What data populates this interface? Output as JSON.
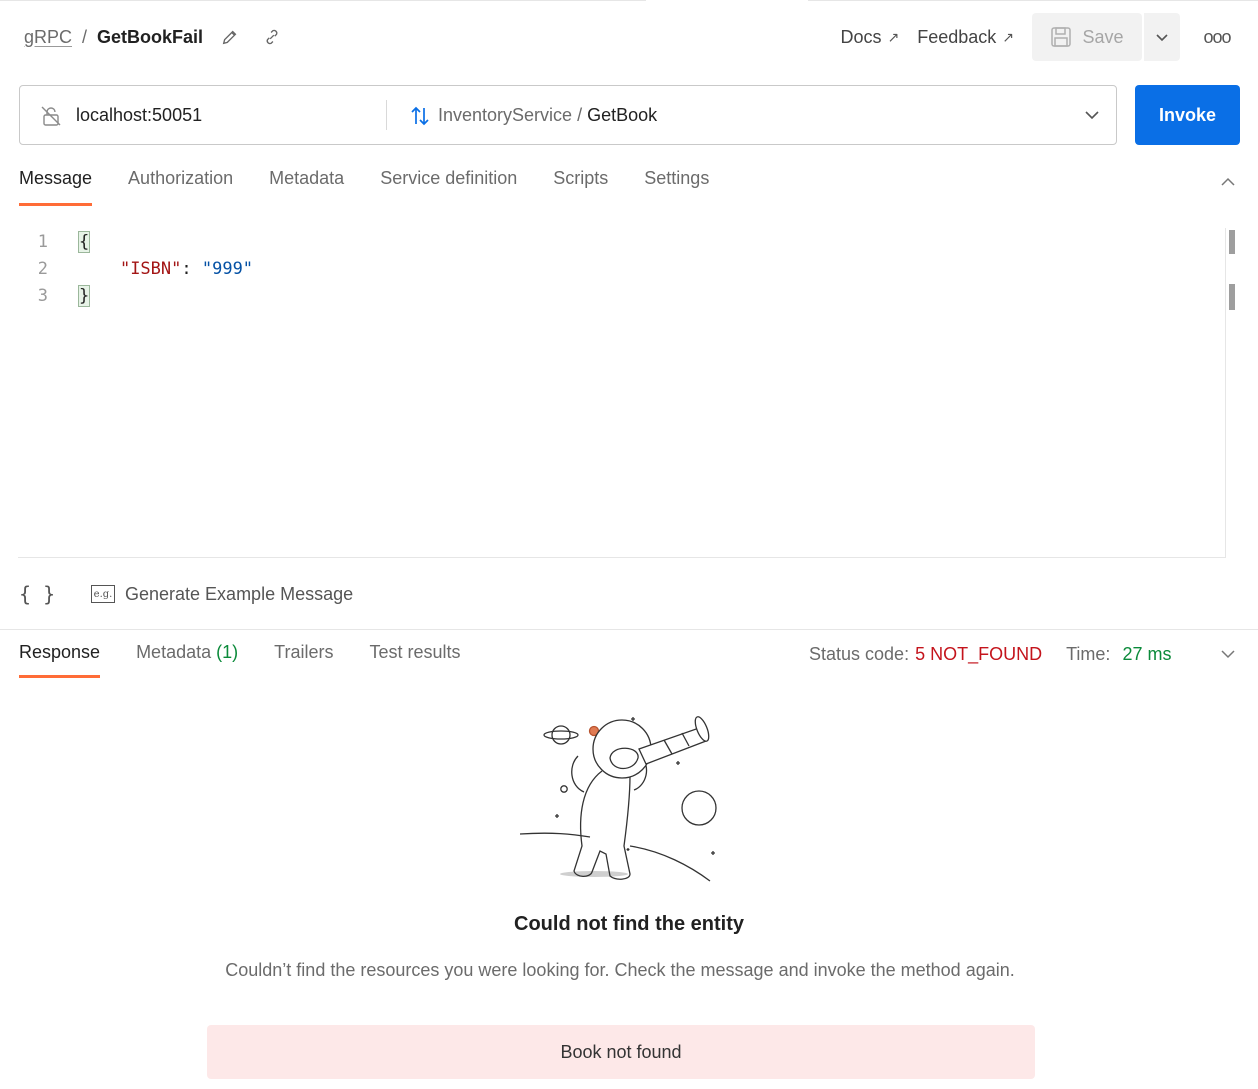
{
  "header": {
    "breadcrumb_parent": "gRPC",
    "breadcrumb_separator": "/",
    "breadcrumb_current": "GetBookFail",
    "docs_label": "Docs",
    "feedback_label": "Feedback",
    "external_arrow": "↗",
    "save_label": "Save",
    "more_label": "ooo"
  },
  "url_bar": {
    "host": "localhost:50051",
    "service": "InventoryService",
    "separator": " / ",
    "method": "GetBook",
    "invoke_label": "Invoke"
  },
  "request_tabs": [
    "Message",
    "Authorization",
    "Metadata",
    "Service definition",
    "Scripts",
    "Settings"
  ],
  "editor": {
    "line_numbers": [
      "1",
      "2",
      "3"
    ],
    "open_brace": "{",
    "close_brace": "}",
    "indent": "    ",
    "key": "\"ISBN\"",
    "colon": ": ",
    "value": "\"999\""
  },
  "editor_footer": {
    "braces_label": "{ }",
    "eg_label": "e.g.",
    "generate_label": "Generate Example Message"
  },
  "response_tabs": {
    "response": "Response",
    "metadata": "Metadata",
    "metadata_count": "(1)",
    "trailers": "Trailers",
    "test_results": "Test results"
  },
  "status": {
    "code_label": "Status code:",
    "code_value": "5 NOT_FOUND",
    "time_label": "Time:",
    "time_value": "27 ms"
  },
  "empty_state": {
    "title": "Could not find the entity",
    "description": "Couldn’t find the resources you were looking for. Check the message and invoke the method again.",
    "error_message": "Book not found"
  },
  "colors": {
    "accent_tab": "#ff6c37",
    "invoke_blue": "#0a6fe6",
    "error_red": "#c4141c",
    "success_green": "#0b8a3a",
    "error_box_bg": "#fde8e8"
  }
}
